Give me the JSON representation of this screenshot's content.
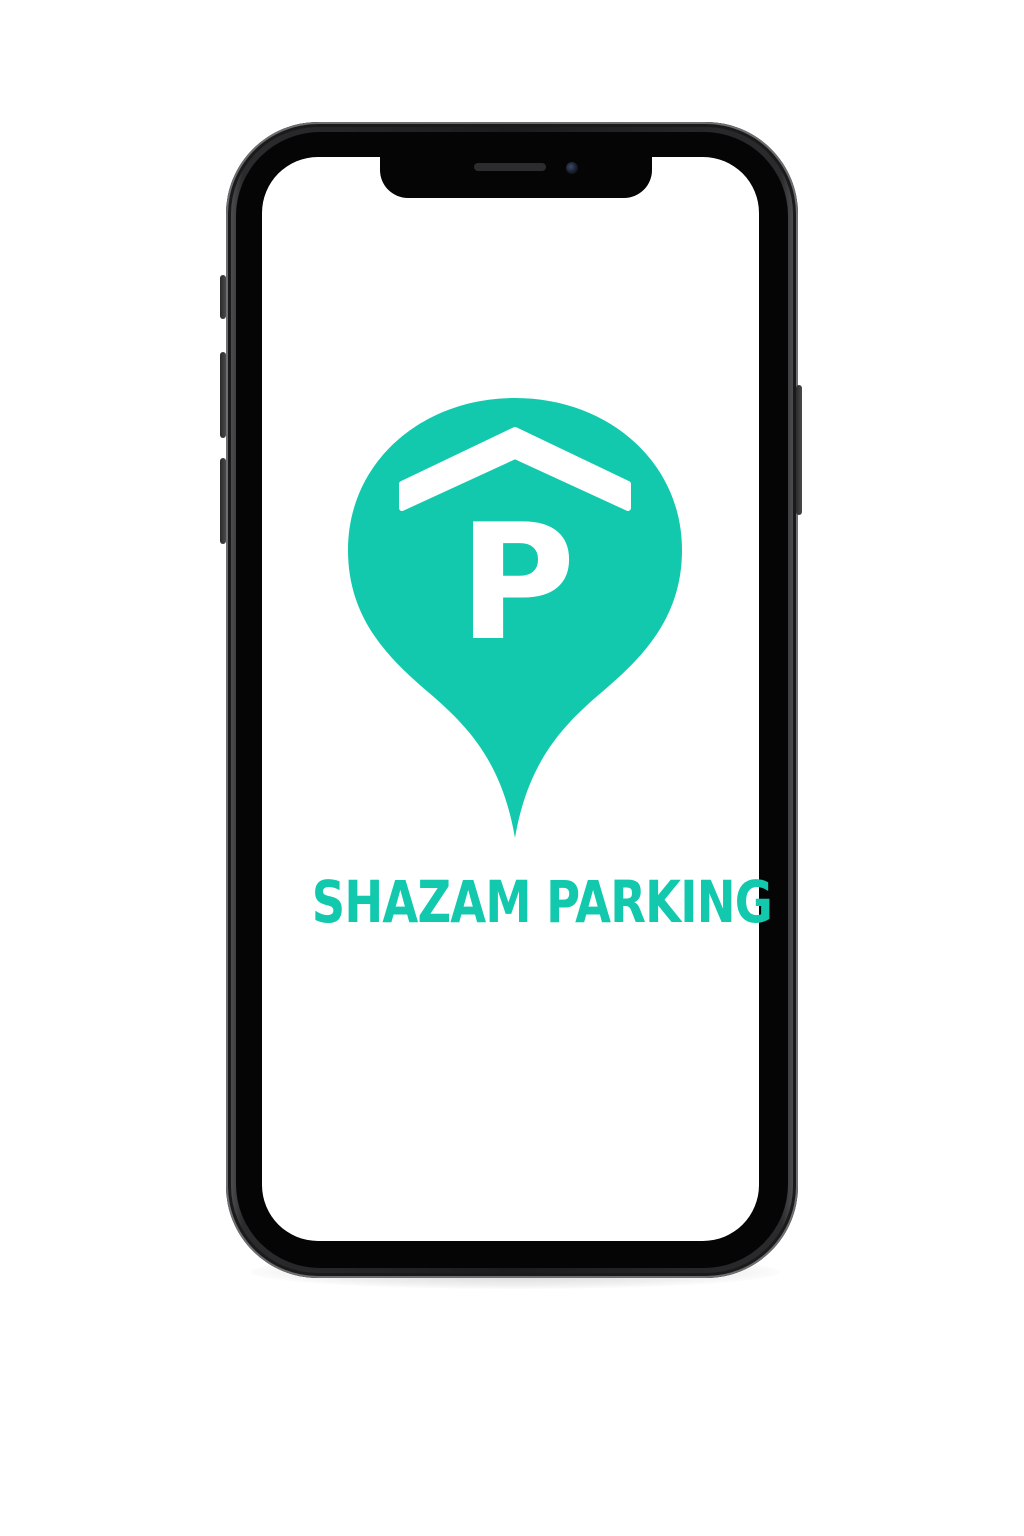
{
  "app": {
    "brand_name": "SHAZAM PARKING",
    "logo_letter": "P"
  },
  "icons": {
    "logo": "parking-location-pin-icon",
    "camera": "front-camera-icon",
    "speaker": "earpiece-speaker-icon"
  },
  "colors": {
    "brand": "#12c9ae",
    "phone_frame": "#1c1c1e",
    "screen_background": "#ffffff"
  }
}
